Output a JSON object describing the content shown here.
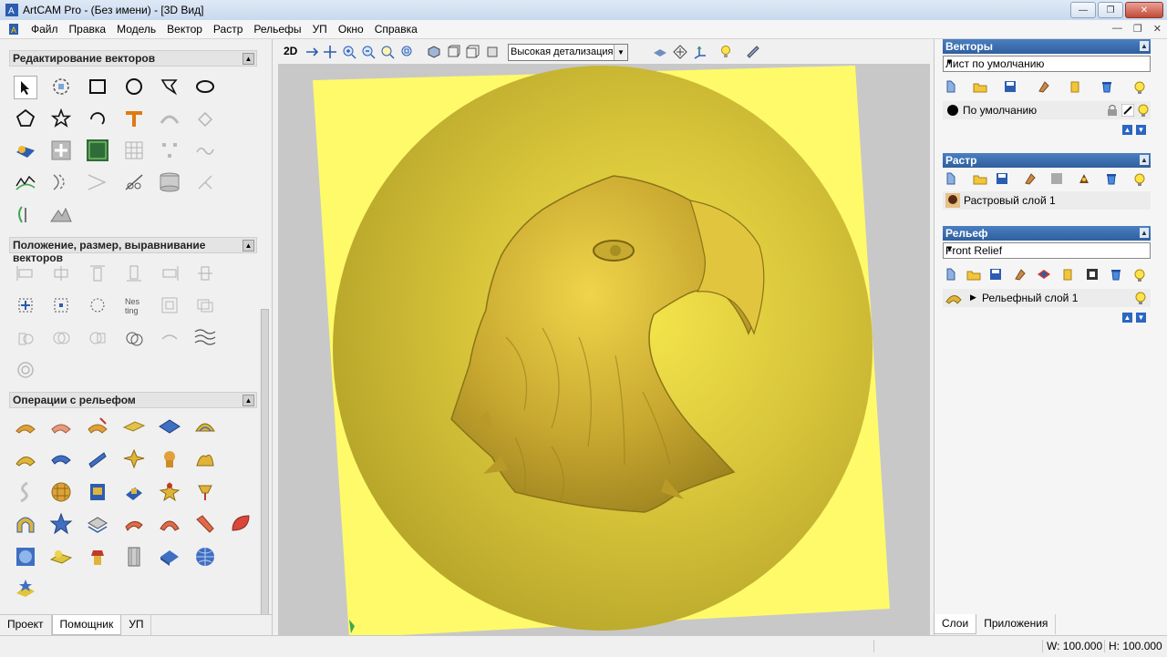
{
  "window": {
    "title": "ArtCAM Pro - (Без имени) - [3D Вид]"
  },
  "menu": {
    "items": [
      "Файл",
      "Правка",
      "Модель",
      "Вектор",
      "Растр",
      "Рельефы",
      "УП",
      "Окно",
      "Справка"
    ]
  },
  "left_panel": {
    "sections": [
      {
        "title": "Редактирование векторов"
      },
      {
        "title": "Положение, размер, выравнивание векторов"
      },
      {
        "title": "Операции с рельефом"
      }
    ],
    "tabs": [
      "Проект",
      "Помощник",
      "УП"
    ],
    "active_tab": "Помощник"
  },
  "toolbar": {
    "mode_label": "2D",
    "quality_select": "Высокая детализация"
  },
  "right_panel": {
    "vectors": {
      "title": "Векторы",
      "sheet_select": "Лист по умолчанию",
      "layer": "По умолчанию"
    },
    "raster": {
      "title": "Растр",
      "layer": "Растровый слой 1"
    },
    "relief": {
      "title": "Рельеф",
      "select": "Front Relief",
      "layer": "Рельефный слой 1"
    },
    "tabs": [
      "Слои",
      "Приложения"
    ],
    "active_tab": "Слои"
  },
  "status": {
    "width": "W: 100.000",
    "height": "H: 100.000"
  },
  "colors": {
    "relief_gold": "#d8c43a",
    "sheet_yellow": "#fffa6a",
    "panel_header": "#3a6fb4"
  }
}
